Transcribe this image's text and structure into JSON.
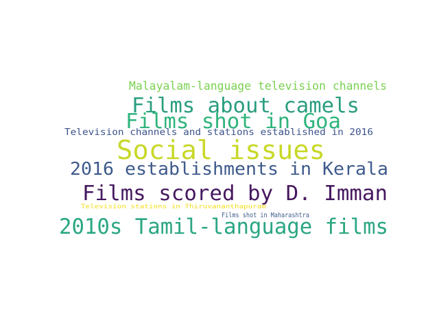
{
  "words": [
    {
      "text": "Malayalam-language television channels",
      "color": "#7ad151"
    },
    {
      "text": "Films about camels",
      "color": "#2a9d7f"
    },
    {
      "text": "Films shot in Goa",
      "color": "#2fb47c"
    },
    {
      "text": "Television channels and stations established in 2016",
      "color": "#3b528b"
    },
    {
      "text": "Social issues",
      "color": "#c8d828"
    },
    {
      "text": "2016 establishments in Kerala",
      "color": "#3e5a8c"
    },
    {
      "text": "Films scored by D. Imman",
      "color": "#46185e"
    },
    {
      "text": "Television stations in Thiruvananthapuram",
      "color": "#f3dd18"
    },
    {
      "text": "Films shot in Maharashtra",
      "color": "#3e5a8c"
    },
    {
      "text": "2010s Tamil-language films",
      "color": "#2aa683"
    }
  ]
}
